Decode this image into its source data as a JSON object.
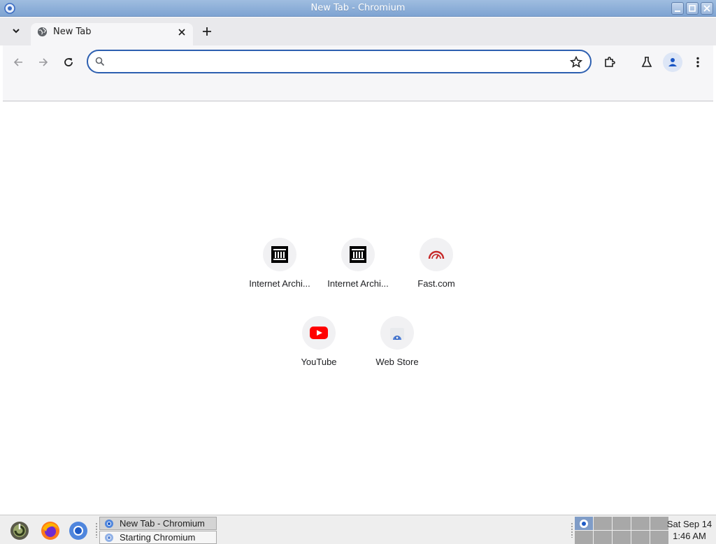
{
  "window": {
    "title": "New Tab - Chromium"
  },
  "tabs": [
    {
      "title": "New Tab"
    }
  ],
  "omnibox": {
    "value": "",
    "placeholder": ""
  },
  "shortcuts": [
    {
      "label": "Internet Archi...",
      "icon": "internet-archive-icon"
    },
    {
      "label": "Internet Archi...",
      "icon": "internet-archive-icon"
    },
    {
      "label": "Fast.com",
      "icon": "speedometer-icon"
    },
    {
      "label": "YouTube",
      "icon": "youtube-icon"
    },
    {
      "label": "Web Store",
      "icon": "web-store-icon"
    }
  ],
  "taskbar": {
    "tasks": [
      {
        "label": "New Tab - Chromium",
        "active": true
      },
      {
        "label": "Starting Chromium",
        "active": false
      }
    ],
    "clock": {
      "date": "Sat Sep 14",
      "time": "1:46 AM"
    }
  },
  "colors": {
    "accent": "#2d5fb0",
    "youtube": "#ff0000",
    "fast": "#c62828"
  }
}
